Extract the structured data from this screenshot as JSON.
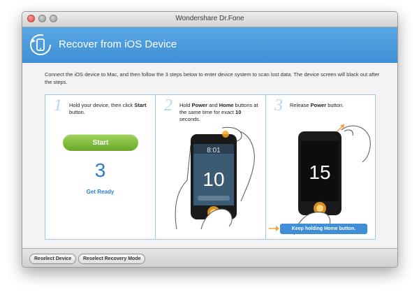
{
  "window": {
    "title": "Wondershare Dr.Fone"
  },
  "header": {
    "title": "Recover from iOS Device",
    "icon": "phone-refresh-icon"
  },
  "instructions": "Connect the iOS device to Mac, and then follow the 3 steps below to enter device system to scan lost data. The device screen will black out after the steps.",
  "steps": [
    {
      "number": "1",
      "text_pre": "Hold your device, then click ",
      "text_bold": "Start",
      "text_post": " button.",
      "start_button": "Start",
      "counter": "3",
      "status": "Get Ready"
    },
    {
      "number": "2",
      "text_a": "Hold ",
      "text_b": "Power",
      "text_c": " and ",
      "text_d": "Home",
      "text_e": " buttons at the same time for exact ",
      "text_f": "10",
      "text_g": " seconds.",
      "screen_time": "8:01",
      "screen_count": "10"
    },
    {
      "number": "3",
      "text_a": "Release ",
      "text_b": "Power",
      "text_c": " button.",
      "screen_count": "15",
      "tooltip": "Keep holding Home button."
    }
  ],
  "footer": {
    "reselect_device": "Reselect Device",
    "reselect_mode": "Reselect Recovery Mode"
  },
  "colors": {
    "header_blue": "#4a9ade",
    "start_green": "#7cba3a",
    "accent_blue": "#2a7fd3",
    "arrow_orange": "#f2a33a"
  }
}
